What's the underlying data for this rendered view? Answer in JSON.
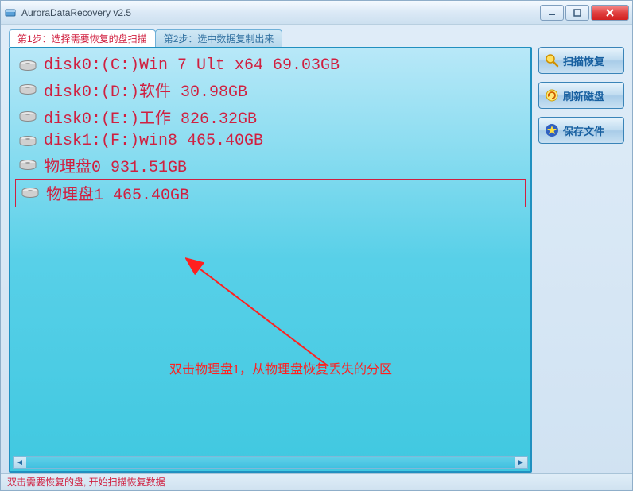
{
  "window": {
    "title": "AuroraDataRecovery v2.5"
  },
  "tabs": [
    {
      "label": "第1步：选择需要恢复的盘扫描",
      "active": true
    },
    {
      "label": "第2步：选中数据复制出来",
      "active": false
    }
  ],
  "disks": [
    {
      "label": "disk0:(C:)Win 7 Ult x64 69.03GB",
      "selected": false
    },
    {
      "label": "disk0:(D:)软件 30.98GB",
      "selected": false
    },
    {
      "label": "disk0:(E:)工作 826.32GB",
      "selected": false
    },
    {
      "label": "disk1:(F:)win8 465.40GB",
      "selected": false
    },
    {
      "label": "物理盘0 931.51GB",
      "selected": false
    },
    {
      "label": "物理盘1 465.40GB",
      "selected": true
    }
  ],
  "annotation": "双击物理盘1，从物理盘恢复丢失的分区",
  "buttons": {
    "scan": "扫描恢复",
    "refresh": "刷新磁盘",
    "save": "保存文件"
  },
  "status": "双击需要恢复的盘, 开始扫描恢复数据",
  "colors": {
    "accent": "#d02040",
    "panel_top": "#b8e8f8",
    "panel_bottom": "#40c8e0"
  }
}
